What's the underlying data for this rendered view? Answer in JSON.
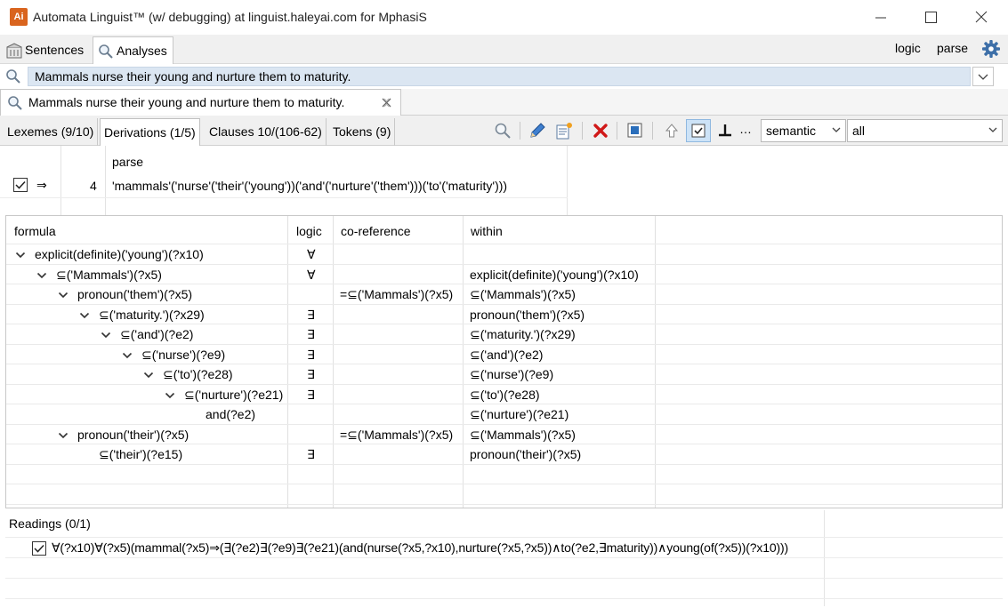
{
  "window": {
    "logo_text": "Ai",
    "title": "Automata Linguist™ (w/ debugging) at linguist.haleyai.com for MphasiS"
  },
  "top_tabs": [
    {
      "label": "Sentences",
      "icon": "building-icon",
      "active": false
    },
    {
      "label": "Analyses",
      "icon": "magnifier-icon",
      "active": true
    }
  ],
  "top_links": {
    "logic": "logic",
    "parse": "parse"
  },
  "search": {
    "value": "Mammals nurse their young and nurture them to maturity."
  },
  "editor_tab": {
    "label": "Mammals nurse their young and nurture them to maturity."
  },
  "sub_tabs": [
    {
      "label": "Lexemes (9/10)",
      "active": false
    },
    {
      "label": "Derivations (1/5)",
      "active": true
    },
    {
      "label": "Clauses 10/(106-62)",
      "active": false
    },
    {
      "label": "Tokens (9)",
      "active": false
    }
  ],
  "toolbar": {
    "more_label": "…",
    "mode_combo": "semantic",
    "filter_combo": "all"
  },
  "parse_table": {
    "header": "parse",
    "row": {
      "arrow": "⇒",
      "count": "4",
      "parse": "'mammals'('nurse'('their'('young'))('and'('nurture'('them')))('to'('maturity')))"
    }
  },
  "formula_table": {
    "headers": {
      "formula": "formula",
      "logic": "logic",
      "coref": "co-reference",
      "within": "within"
    },
    "rows": [
      {
        "formula": "explicit(definite)('young')(?x10)",
        "depth": 0,
        "expanded": true,
        "logic": "∀",
        "coref": "",
        "within": ""
      },
      {
        "formula": "⊆('Mammals')(?x5)",
        "depth": 1,
        "expanded": true,
        "logic": "∀",
        "coref": "",
        "within": "explicit(definite)('young')(?x10)"
      },
      {
        "formula": "pronoun('them')(?x5)",
        "depth": 2,
        "expanded": true,
        "logic": "",
        "coref": "=⊆('Mammals')(?x5)",
        "within": "⊆('Mammals')(?x5)"
      },
      {
        "formula": "⊆('maturity.')(?x29)",
        "depth": 3,
        "expanded": true,
        "logic": "∃",
        "coref": "",
        "within": "pronoun('them')(?x5)"
      },
      {
        "formula": "⊆('and')(?e2)",
        "depth": 4,
        "expanded": true,
        "logic": "∃",
        "coref": "",
        "within": "⊆('maturity.')(?x29)"
      },
      {
        "formula": "⊆('nurse')(?e9)",
        "depth": 5,
        "expanded": true,
        "logic": "∃",
        "coref": "",
        "within": "⊆('and')(?e2)"
      },
      {
        "formula": "⊆('to')(?e28)",
        "depth": 6,
        "expanded": true,
        "logic": "∃",
        "coref": "",
        "within": "⊆('nurse')(?e9)"
      },
      {
        "formula": "⊆('nurture')(?e21)",
        "depth": 7,
        "expanded": true,
        "logic": "∃",
        "coref": "",
        "within": "⊆('to')(?e28)"
      },
      {
        "formula": "and(?e2)",
        "depth": 8,
        "expanded": false,
        "logic": "",
        "coref": "",
        "within": "⊆('nurture')(?e21)"
      },
      {
        "formula": "pronoun('their')(?x5)",
        "depth": 2,
        "expanded": true,
        "logic": "",
        "coref": "=⊆('Mammals')(?x5)",
        "within": "⊆('Mammals')(?x5)"
      },
      {
        "formula": "⊆('their')(?e15)",
        "depth": 3,
        "expanded": false,
        "logic": "∃",
        "coref": "",
        "within": "pronoun('their')(?x5)"
      }
    ]
  },
  "readings": {
    "title": "Readings (0/1)",
    "items": [
      {
        "checked": true,
        "text": "∀(?x10)∀(?x5)(mammal(?x5)⇒(∃(?e2)∃(?e9)∃(?e21)(and(nurse(?x5,?x10),nurture(?x5,?x5))∧to(?e2,∃maturity))∧young(of(?x5))(?x10)))"
      }
    ]
  },
  "colors": {
    "accent_blue": "#2a6ebb",
    "logo_orange": "#d9641e",
    "search_bg": "#dbe6f2",
    "delete_red": "#d01818"
  }
}
